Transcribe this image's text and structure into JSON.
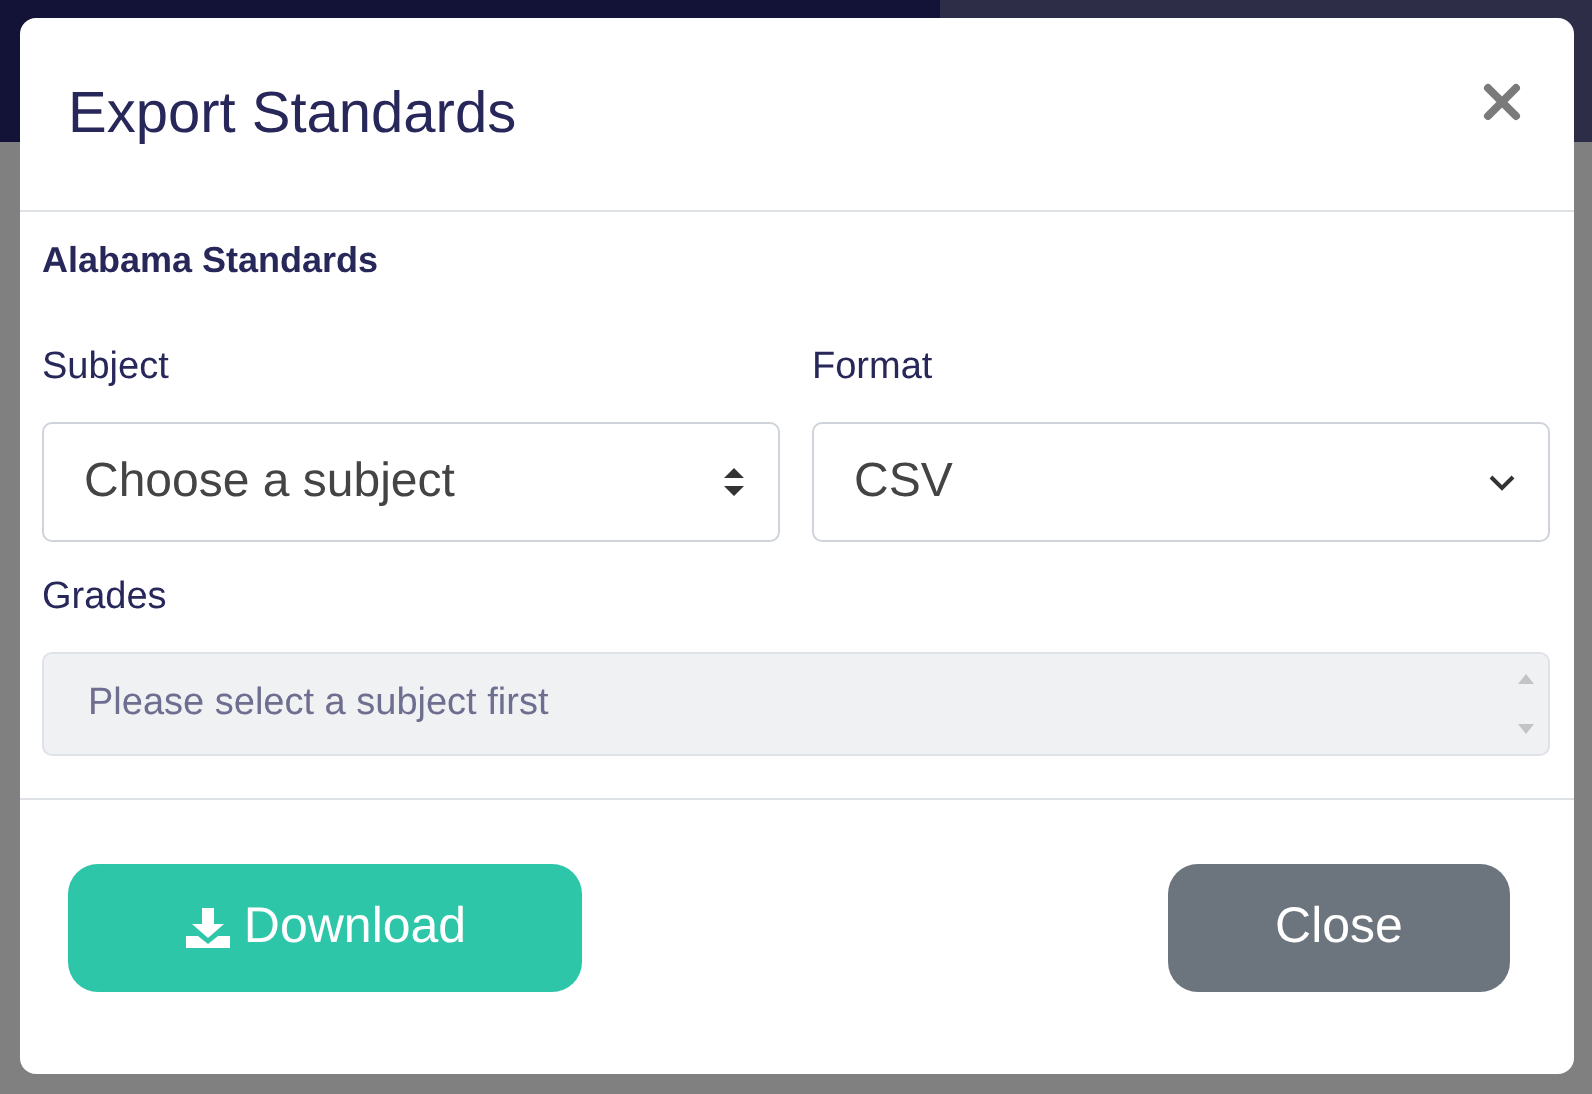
{
  "modal": {
    "title": "Export Standards",
    "heading": "Alabama Standards",
    "fields": [
      {
        "kind": "updown",
        "label": "Subject",
        "value": "Choose a subject"
      },
      {
        "kind": "chevron",
        "label": "Format",
        "value": "CSV"
      }
    ],
    "grades": {
      "label": "Grades",
      "text": "Please select a subject first",
      "disabled": true
    },
    "buttons": [
      {
        "kind": "download",
        "label": "Download"
      },
      {
        "kind": "close",
        "label": "Close"
      }
    ]
  }
}
